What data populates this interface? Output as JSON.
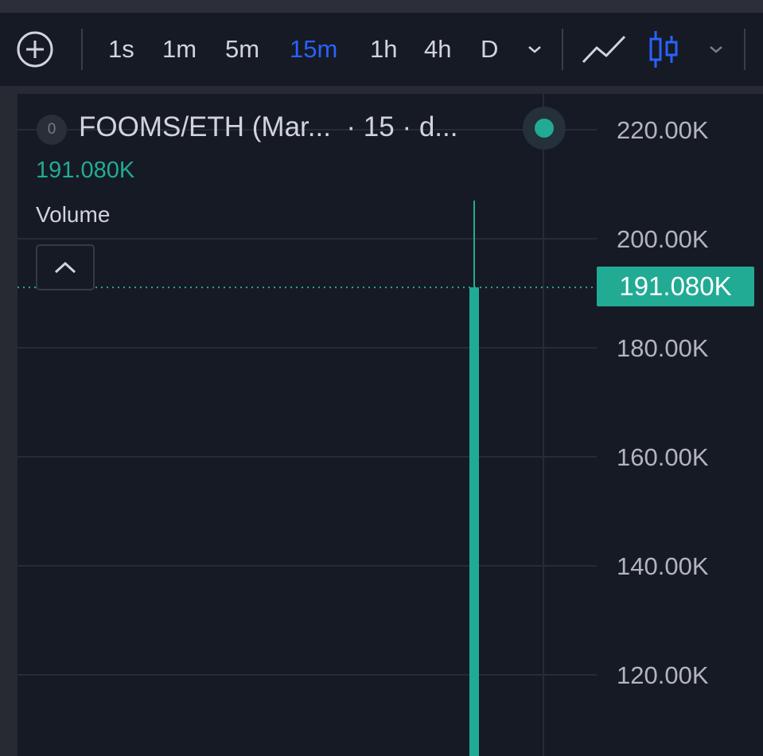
{
  "toolbar": {
    "add_icon": "plus-circle-icon",
    "timeframes": [
      "1s",
      "1m",
      "5m",
      "15m",
      "1h",
      "4h",
      "D"
    ],
    "active_timeframe": "15m",
    "more_timeframes_icon": "chevron-down-icon",
    "line_chart_icon": "line-chart-icon",
    "candles_icon": "candlestick-icon",
    "chart_type_menu_icon": "chevron-down-icon"
  },
  "legend": {
    "badge": "0",
    "symbol": "FOOMS/ETH (Mar...",
    "interval": "· 15 · d...",
    "price": "191.080K",
    "indicator": "Volume",
    "collapse_icon": "chevron-up-icon"
  },
  "price_axis": {
    "labels": [
      "220.00K",
      "200.00K",
      "180.00K",
      "160.00K",
      "140.00K",
      "120.00K"
    ],
    "last_price": "191.080K"
  },
  "colors": {
    "up": "#22ab94",
    "accent": "#2962ff",
    "background": "#161a25",
    "text": "#d1d4dc"
  },
  "chart_data": {
    "type": "candlestick",
    "y_ticks": [
      220000,
      200000,
      180000,
      160000,
      140000,
      120000
    ],
    "last_price": 191080,
    "candles": [
      {
        "close": 191080,
        "high": 207000,
        "low_below_visible": true
      }
    ]
  }
}
